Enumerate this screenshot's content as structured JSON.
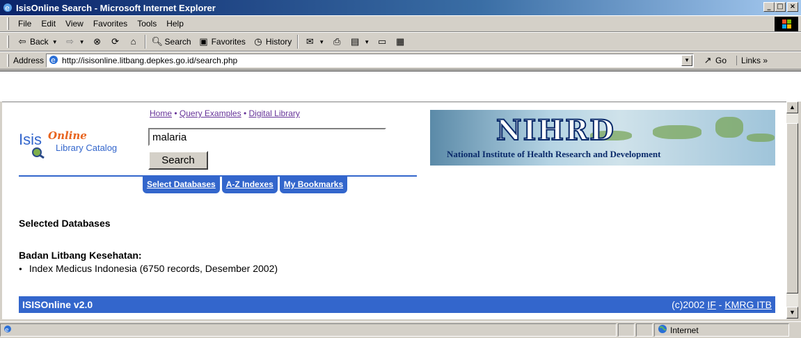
{
  "window": {
    "title": "IsisOnline Search - Microsoft Internet Explorer",
    "controls": {
      "minimize": "_",
      "maximize": "□",
      "close": "×"
    }
  },
  "menu": [
    {
      "label": "File"
    },
    {
      "label": "Edit"
    },
    {
      "label": "View"
    },
    {
      "label": "Favorites"
    },
    {
      "label": "Tools"
    },
    {
      "label": "Help"
    }
  ],
  "toolbar": {
    "back": "Back",
    "search": "Search",
    "favorites": "Favorites",
    "history": "History"
  },
  "address": {
    "label": "Address",
    "url": "http://isisonline.litbang.depkes.go.id/search.php",
    "go": "Go",
    "links": "Links"
  },
  "logo": {
    "isis": "Isis",
    "online": "Online",
    "library_catalog": "Library Catalog"
  },
  "nav_links": [
    "Home",
    "Query Examples",
    "Digital Library"
  ],
  "search": {
    "value": "malaria",
    "button": "Search"
  },
  "banner": {
    "title": "NIHRD",
    "subtitle": "National Institute of Health Research and Development"
  },
  "tabs": [
    "Select Databases",
    "A-Z Indexes",
    "My Bookmarks"
  ],
  "content": {
    "selected_title": "Selected Databases",
    "org_title": "Badan Litbang Kesehatan:",
    "db_item": "Index Medicus Indonesia (6750 records, Desember 2002)"
  },
  "footer": {
    "version": "ISISOnline v2.0",
    "copyright_prefix": "(c)2002",
    "link_if": "IF",
    "link_kmrg": "KMRG ITB"
  },
  "status": {
    "zone": "Internet"
  },
  "colors": {
    "accent": "#3366cc",
    "link_visited": "#663399",
    "title_bar": "#0a246a"
  }
}
